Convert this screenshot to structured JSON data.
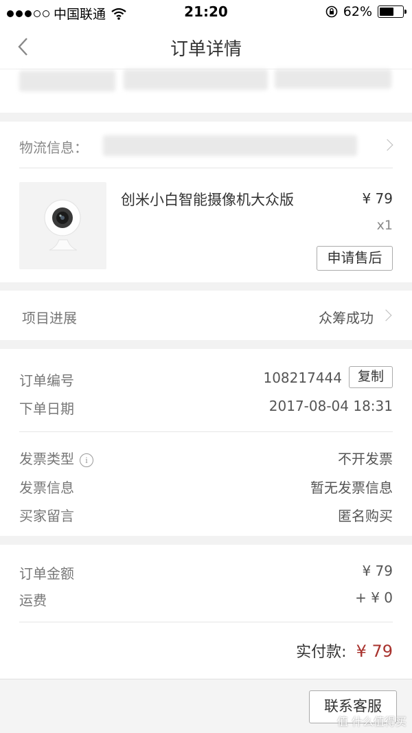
{
  "status": {
    "carrier": "中国联通",
    "time": "21:20",
    "battery": "62%",
    "battery_level": 0.62
  },
  "nav": {
    "title": "订单详情"
  },
  "logistics": {
    "label": "物流信息："
  },
  "product": {
    "name": "创米小白智能摄像机大众版",
    "price": "¥ 79",
    "qty": "x1",
    "after_sale_label": "申请售后"
  },
  "progress": {
    "label": "项目进展",
    "value": "众筹成功"
  },
  "order": {
    "number_label": "订单编号",
    "number": "108217444",
    "copy_label": "复制",
    "date_label": "下单日期",
    "date": "2017-08-04 18:31"
  },
  "invoice": {
    "type_label": "发票类型",
    "type_value": "不开发票",
    "info_label": "发票信息",
    "info_value": "暂无发票信息",
    "note_label": "买家留言",
    "note_value": "匿名购买"
  },
  "amount": {
    "total_label": "订单金额",
    "total": "¥ 79",
    "shipping_label": "运费",
    "shipping": "+ ¥ 0",
    "paid_label": "实付款:",
    "paid": "¥ 79",
    "paid_color": "#a8322d"
  },
  "footer": {
    "contact_label": "联系客服",
    "watermark": "值 什么值得买"
  }
}
